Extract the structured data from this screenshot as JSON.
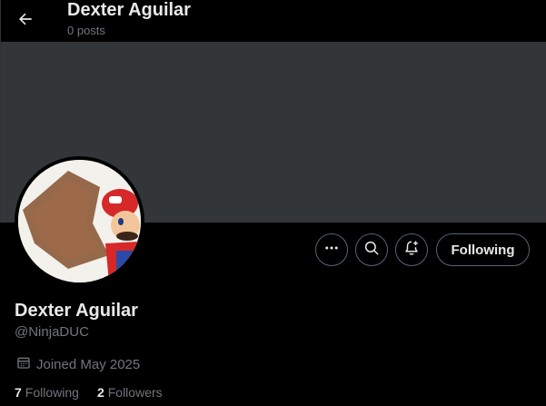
{
  "header": {
    "title": "Dexter Aguilar",
    "post_count": "0 posts"
  },
  "profile": {
    "name": "Dexter Aguilar",
    "handle": "@NinjaDUC",
    "joined": "Joined May 2025",
    "following_count": "7",
    "following_label": "Following",
    "followers_count": "2",
    "followers_label": "Followers"
  },
  "actions": {
    "more_icon": "more-icon",
    "search_icon": "search-icon",
    "notify_icon": "bell-plus-icon",
    "follow_label": "Following"
  },
  "colors": {
    "background": "#000000",
    "banner": "#333639",
    "text_primary": "#e7e9ea",
    "text_secondary": "#71767b",
    "border": "#536471"
  }
}
